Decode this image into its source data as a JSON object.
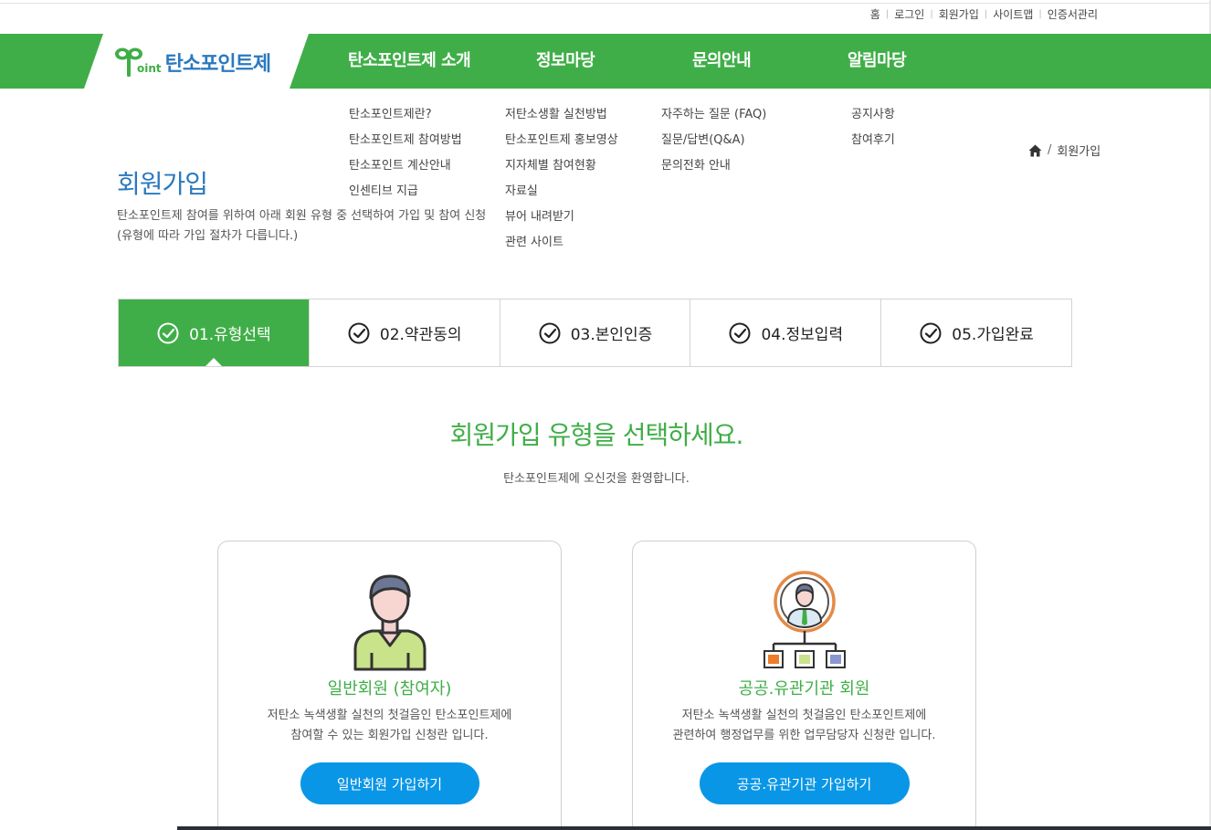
{
  "util_links": [
    "홈",
    "로그인",
    "회원가입",
    "사이트맵",
    "인증서관리"
  ],
  "logo": {
    "word": "oint",
    "name": "탄소포인트제"
  },
  "gnb": [
    {
      "label": "탄소포인트제 소개",
      "sub": [
        "탄소포인트제란?",
        "탄소포인트제 참여방법",
        "탄소포인트 계산안내",
        "인센티브 지급"
      ]
    },
    {
      "label": "정보마당",
      "sub": [
        "저탄소생활 실천방법",
        "탄소포인트제 홍보영상",
        "지자체별 참여현황",
        "자료실",
        "뷰어 내려받기",
        "관련 사이트"
      ]
    },
    {
      "label": "문의안내",
      "sub": [
        "자주하는 질문 (FAQ)",
        "질문/답변(Q&A)",
        "문의전화 안내"
      ]
    },
    {
      "label": "알림마당",
      "sub": [
        "공지사항",
        "참여후기"
      ]
    }
  ],
  "page": {
    "title": "회원가입",
    "desc_line1": "탄소포인트제 참여를 위하여 아래 회원 유형 중 선택하여 가입 및 참여 신청",
    "desc_line2": "(유형에 따라 가입 절차가 다릅니다.)"
  },
  "breadcrumb": {
    "home_icon": "home-icon",
    "separator": "/",
    "current": "회원가입"
  },
  "steps": [
    {
      "label": "01.유형선택",
      "active": true
    },
    {
      "label": "02.약관동의",
      "active": false
    },
    {
      "label": "03.본인인증",
      "active": false
    },
    {
      "label": "04.정보입력",
      "active": false
    },
    {
      "label": "05.가입완료",
      "active": false
    }
  ],
  "select": {
    "title": "회원가입 유형을 선택하세요.",
    "subtitle": "탄소포인트제에 오신것을 환영합니다."
  },
  "cards": [
    {
      "icon": "person-icon",
      "title": "일반회원 (참여자)",
      "desc_line1": "저탄소 녹색생활 실천의 첫걸음인 탄소포인트제에",
      "desc_line2": "참여할 수 있는 회원가입 신청란 입니다.",
      "button": "일반회원 가입하기"
    },
    {
      "icon": "organization-icon",
      "title": "공공.유관기관 회원",
      "desc_line1": "저탄소 녹색생활 실천의 첫걸음인 탄소포인트제에",
      "desc_line2": "관련하여 행정업무를 위한 업무담당자 신청란 입니다.",
      "button": "공공.유관기관 가입하기"
    }
  ],
  "colors": {
    "brand_green": "#40ae48",
    "brand_blue": "#2b79bf",
    "button_blue": "#0a96e6"
  }
}
